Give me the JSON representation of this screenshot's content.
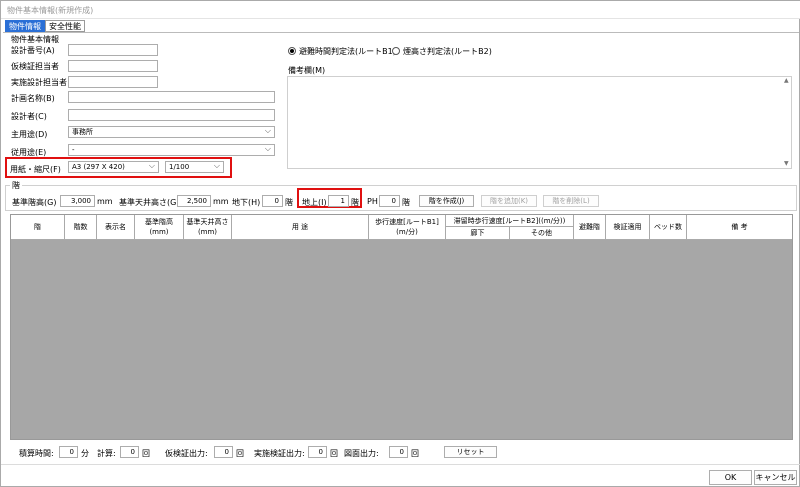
{
  "window": {
    "title": "物件基本情報(新規作成)"
  },
  "tabs": [
    {
      "label": "物件情報"
    },
    {
      "label": "安全性能"
    }
  ],
  "basic": {
    "group_title": "物件基本情報",
    "design_no": {
      "label": "設計番号(A)",
      "value": ""
    },
    "provisional_manager": {
      "label": "仮検証担当者",
      "value": ""
    },
    "actual_manager": {
      "label": "実施設計担当者",
      "value": ""
    },
    "plan_name": {
      "label": "計画名称(B)",
      "value": ""
    },
    "designer": {
      "label": "設計者(C)",
      "value": ""
    },
    "main_use": {
      "label": "主用途(D)",
      "value": "事務所"
    },
    "sub_use": {
      "label": "従用途(E)",
      "value": "-"
    },
    "paper_scale": {
      "label": "用紙・縮尺(F)",
      "paper": "A3 (297 X 420)",
      "scale": "1/100"
    }
  },
  "method": {
    "route_b1": "避難時間判定法(ルートB1)",
    "route_b2": "煙高さ判定法(ルートB2)",
    "selected": "route_b1",
    "memo_label": "備考欄(M)",
    "memo_value": ""
  },
  "floor": {
    "group_title": "階",
    "std_height": {
      "label": "基準階高(G)",
      "value": "3,000",
      "unit": "mm"
    },
    "std_ceiling": {
      "label": "基準天井高さ(G)",
      "value": "2,500",
      "unit": "mm"
    },
    "basement": {
      "label": "地下(H)",
      "value": "0",
      "unit": "階"
    },
    "above": {
      "label": "地上(I)",
      "value": "1",
      "unit": "階"
    },
    "ph": {
      "label": "PH",
      "value": "0",
      "unit": "階"
    },
    "create_btn": "階を作成(J)",
    "add_btn": "階を追加(K)",
    "delete_btn": "階を削除(L)"
  },
  "table": {
    "headers": {
      "floor": "階",
      "count": "階数",
      "display": "表示名",
      "height": "基準階高",
      "height_unit": "(mm)",
      "ceiling": "基準天井高さ",
      "ceiling_unit": "(mm)",
      "use": "用 途",
      "walk": "歩行速度[ルートB1]",
      "walk_unit": "(m/分)",
      "stay": "滞留時歩行速度[ルートB2]((m/分))",
      "corridor": "廊下",
      "other": "その他",
      "refuge": "避難階",
      "verify": "検証適用",
      "beds": "ベッド数",
      "remarks": "備 考"
    }
  },
  "footer": {
    "calc_time": {
      "label": "積算時間:",
      "value": "0",
      "unit": "分"
    },
    "calc": {
      "label": "計算:",
      "value": "0",
      "unit": "回"
    },
    "prov_out": {
      "label": "仮検証出力:",
      "value": "0",
      "unit": "回"
    },
    "actual_out": {
      "label": "実施検証出力:",
      "value": "0",
      "unit": "回"
    },
    "drawing_out": {
      "label": "図面出力:",
      "value": "0",
      "unit": "回"
    },
    "reset": "リセット"
  },
  "buttons": {
    "ok": "OK",
    "cancel": "キャンセル"
  }
}
